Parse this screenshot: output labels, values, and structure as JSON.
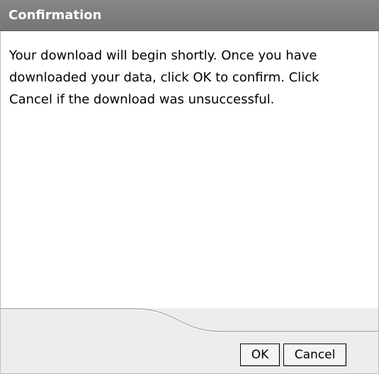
{
  "dialog": {
    "title": "Confirmation",
    "message": "Your download will begin shortly. Once you have downloaded your data, click OK to confirm. Click Cancel if the download was unsuccessful.",
    "buttons": {
      "ok_label": "OK",
      "cancel_label": "Cancel"
    }
  }
}
